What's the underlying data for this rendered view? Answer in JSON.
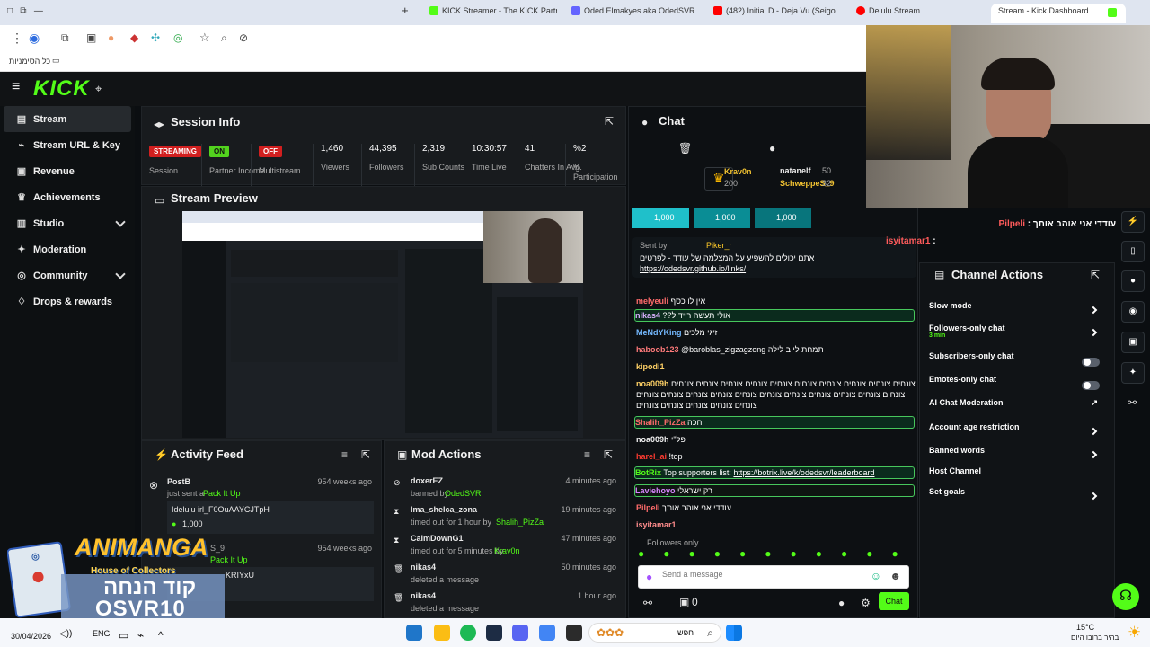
{
  "browser": {
    "tabs": [
      "KICK Streamer - The KICK Partn",
      "Oded Elmakyes aka OdedSVR",
      "(482) Initial D - Deja Vu (Seigo",
      "Delulu Stream",
      "Stream - Kick Dashboard"
    ],
    "bookmarks_label": "כל הסימניות"
  },
  "sidebar": {
    "items": [
      {
        "label": "Stream"
      },
      {
        "label": "Stream URL & Key"
      },
      {
        "label": "Revenue"
      },
      {
        "label": "Achievements"
      },
      {
        "label": "Studio"
      },
      {
        "label": "Moderation"
      },
      {
        "label": "Community"
      },
      {
        "label": "Drops & rewards"
      }
    ]
  },
  "session": {
    "title": "Session Info",
    "stats": [
      {
        "value": "STREAMING",
        "label": "Session"
      },
      {
        "value": "ON",
        "label": "Partner Income"
      },
      {
        "value": "OFF",
        "label": "Multistream"
      },
      {
        "value": "1,460",
        "label": "Viewers"
      },
      {
        "value": "44,395",
        "label": "Followers"
      },
      {
        "value": "2,319",
        "label": "Sub Counts"
      },
      {
        "value": "10:30:57",
        "label": "Time Live"
      },
      {
        "value": "41",
        "label": "Chatters In Avg."
      },
      {
        "value": "%2",
        "label": "% Participation"
      }
    ]
  },
  "preview": {
    "title": "Stream Preview"
  },
  "activity": {
    "title": "Activity Feed",
    "items": [
      {
        "user": "PostB",
        "time": "954 weeks ago",
        "action": "just sent a",
        "item": "Pack It Up",
        "message": "Idelulu irl_F0OuAAYCJTpH",
        "amount": "1,000"
      },
      {
        "user": "S_9",
        "time": "954 weeks ago",
        "action": "",
        "item": "Pack It Up",
        "message": "KRIYxU",
        "amount": ""
      }
    ]
  },
  "mod": {
    "title": "Mod Actions",
    "items": [
      {
        "user": "doxerEZ",
        "detail": "banned by",
        "actor": "OdedSVR",
        "time": "4 minutes ago"
      },
      {
        "user": "lma_shelca_zona",
        "detail": "timed out for 1 hour by",
        "actor": "Shalih_PizZa",
        "time": "19 minutes ago"
      },
      {
        "user": "CalmDownG1",
        "detail": "timed out for 5 minutes by",
        "actor": "Krav0n",
        "time": "47 minutes ago"
      },
      {
        "user": "nikas4",
        "detail": "deleted a message",
        "actor": "",
        "time": "50 minutes ago"
      },
      {
        "user": "nikas4",
        "detail": "deleted a message",
        "actor": "",
        "time": "1 hour ago"
      }
    ]
  },
  "chat": {
    "title": "Chat",
    "top_users": [
      {
        "name": "Krav0n",
        "amount": "200"
      },
      {
        "name": "natanelf",
        "amount": "50"
      },
      {
        "name": "SchweppeS_9",
        "amount": "32"
      }
    ],
    "gifts": [
      "1,000",
      "1,000",
      "1,000"
    ],
    "pinned": {
      "sent_by": "Sent by",
      "user": "Piker_r",
      "text": "אתם יכולים להשפיע על המצלמה של עודד - לפרטים",
      "link": "https://odedsvr.github.io/links/"
    },
    "messages": [
      {
        "user": "melyeuli",
        "text": "אין לו כסף"
      },
      {
        "user": "nikas4",
        "text": "??אולי תעשה רייד ל"
      },
      {
        "user": "MeNdYKing",
        "text": "זיגי מלכים"
      },
      {
        "user": "haboob123",
        "text": "@baroblas_zigzagzong תמחת לי ב לילה"
      },
      {
        "user": "kipodi1",
        "text": ""
      },
      {
        "user": "noa009h",
        "text": "צונחים צונחים צונחים צונחים צונחים צונחים צונחים צונחים צונחים צונחים צונחים צונחים צונחים צונחים צונחים צונחים צונחים צונחים צונחים צונחים צונחים צונחים צונחים צונחים צונחים צונחים"
      },
      {
        "user": "Shalih_PizZa",
        "text": "חכה"
      },
      {
        "user": "noa009h",
        "text": "פל\"י"
      },
      {
        "user": "harel_ai",
        "text": "!top"
      },
      {
        "user": "BotRix",
        "text": "Top supporters list:",
        "link": "https://botrix.live/k/odedsvr/leaderboard"
      },
      {
        "user": "Laviehoyo",
        "text": "רק ישראלי"
      },
      {
        "user": "Pilpeli",
        "text": "עודדי אני אוהב אותך"
      },
      {
        "user": "isyitamar1",
        "text": ""
      }
    ],
    "followers_only": "Followers only",
    "placeholder": "Send a message",
    "viewers": "0",
    "button": "Chat"
  },
  "channel_actions": {
    "title": "Channel Actions",
    "items": [
      {
        "label": "Slow mode",
        "sub": ""
      },
      {
        "label": "Followers-only chat",
        "sub": "3 min"
      },
      {
        "label": "Subscribers-only chat",
        "sub": ""
      },
      {
        "label": "Emotes-only chat",
        "sub": ""
      },
      {
        "label": "AI Chat Moderation",
        "sub": ""
      },
      {
        "label": "Account age restriction",
        "sub": ""
      },
      {
        "label": "Banned words",
        "sub": ""
      },
      {
        "label": "Host Channel",
        "sub": ""
      },
      {
        "label": "Set goals",
        "sub": ""
      }
    ]
  },
  "overlay": {
    "top_messages": [
      {
        "user": "Pilpeli",
        "text": "עודדי אני אוהב אותך"
      },
      {
        "user": "isyitamar1",
        "text": ""
      }
    ],
    "brand": "ANIMANGA",
    "brand_sub": "House of Collectors",
    "code_label": "קוד הנחה",
    "code": "OSVR10"
  },
  "taskbar": {
    "date": "30/04/2026",
    "lang": "ENG",
    "search": "חפש",
    "weather": "15°C",
    "weather_text": "בהיר ברובו היום"
  }
}
